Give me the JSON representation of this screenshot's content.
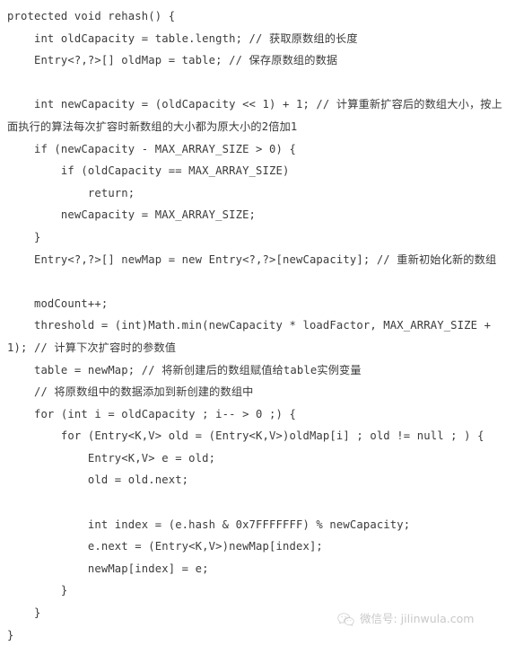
{
  "document": {
    "kind": "code-snippet",
    "language": "java",
    "background_color": "#ffffff",
    "text_color": "#3b3b3b"
  },
  "code": {
    "lines": [
      "protected void rehash() {",
      "    int oldCapacity = table.length; // 获取原数组的长度",
      "    Entry<?,?>[] oldMap = table; // 保存原数组的数据",
      "",
      "    int newCapacity = (oldCapacity << 1) + 1; // 计算重新扩容后的数组大小，按上面执行的算法每次扩容时新数组的大小都为原大小的2倍加1",
      "    if (newCapacity - MAX_ARRAY_SIZE > 0) {",
      "        if (oldCapacity == MAX_ARRAY_SIZE)",
      "            return;",
      "        newCapacity = MAX_ARRAY_SIZE;",
      "    }",
      "    Entry<?,?>[] newMap = new Entry<?,?>[newCapacity]; // 重新初始化新的数组",
      "",
      "    modCount++;",
      "    threshold = (int)Math.min(newCapacity * loadFactor, MAX_ARRAY_SIZE + 1); // 计算下次扩容时的参数值",
      "    table = newMap; // 将新创建后的数组赋值给table实例变量",
      "    // 将原数组中的数据添加到新创建的数组中",
      "    for (int i = oldCapacity ; i-- > 0 ;) {",
      "        for (Entry<K,V> old = (Entry<K,V>)oldMap[i] ; old != null ; ) {",
      "            Entry<K,V> e = old;",
      "            old = old.next;",
      "",
      "            int index = (e.hash & 0x7FFFFFFF) % newCapacity;",
      "            e.next = (Entry<K,V>)newMap[index];",
      "            newMap[index] = e;",
      "        }",
      "    }",
      "}"
    ]
  },
  "watermark": {
    "icon": "wechat-logo-icon",
    "text": "微信号: jilinwula.com"
  }
}
